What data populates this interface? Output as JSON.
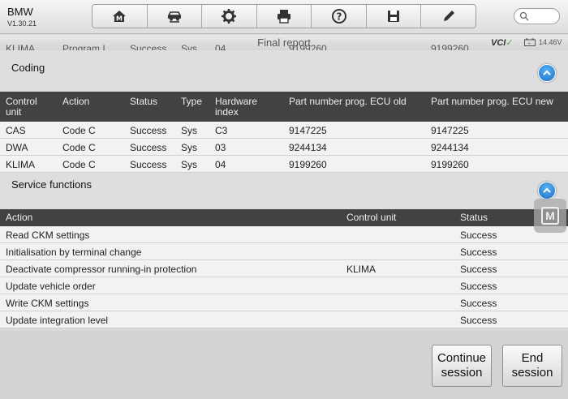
{
  "app": {
    "make": "BMW",
    "version": "V1.30.21"
  },
  "toolbar": {
    "tools": [
      "home-icon",
      "vehicle-swap-icon",
      "gear-icon",
      "printer-icon",
      "help-icon",
      "save-icon",
      "pen-icon"
    ]
  },
  "header": {
    "title": "Final report",
    "vci_label": "VCI",
    "voltage": "14.46V",
    "ghost_row": [
      "KLIMA",
      "Program I",
      "Success",
      "Sys",
      "04",
      "9199260",
      "9199260"
    ]
  },
  "coding": {
    "title": "Coding",
    "columns": [
      "Control\nunit",
      "Action",
      "Status",
      "Type",
      "Hardware\nindex",
      "Part number prog. ECU old",
      "Part number prog. ECU new"
    ],
    "rows": [
      [
        "CAS",
        "Code C",
        "Success",
        "Sys",
        "C3",
        "9147225",
        "9147225"
      ],
      [
        "DWA",
        "Code C",
        "Success",
        "Sys",
        "03",
        "9244134",
        "9244134"
      ],
      [
        "KLIMA",
        "Code C",
        "Success",
        "Sys",
        "04",
        "9199260",
        "9199260"
      ]
    ]
  },
  "service": {
    "title": "Service functions",
    "columns": [
      "Action",
      "Control unit",
      "Status"
    ],
    "rows": [
      [
        "Read CKM settings",
        "",
        "Success"
      ],
      [
        "Initialisation by terminal change",
        "",
        "Success"
      ],
      [
        "Deactivate compressor running-in protection",
        "KLIMA",
        "Success"
      ],
      [
        "Update vehicle order",
        "",
        "Success"
      ],
      [
        "Write CKM settings",
        "",
        "Success"
      ],
      [
        "Update integration level",
        "",
        "Success"
      ]
    ]
  },
  "floating_badge": "M",
  "buttons": {
    "continue": "Continue session",
    "end": "End session"
  },
  "colors": {
    "accent": "#1b6fc6",
    "header_dark": "#424242",
    "vci_green": "#44b030"
  }
}
